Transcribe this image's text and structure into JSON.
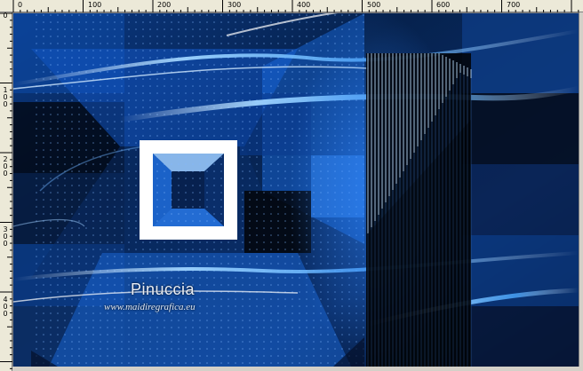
{
  "ruler": {
    "horizontal": [
      "0",
      "100",
      "200",
      "300",
      "400",
      "500",
      "600",
      "700"
    ],
    "vertical": [
      "1\n0\n0",
      "2\n0\n0",
      "3\n0\n0",
      "4\n0\n0"
    ],
    "corner": "0"
  },
  "artwork": {
    "watermark_name": "Pinuccia",
    "watermark_url": "www.maidiregrafica.eu",
    "colors": {
      "deep": "#061022",
      "blue": "#1a5fb4",
      "bright": "#3a9cff",
      "frame": "#ffffff"
    }
  }
}
